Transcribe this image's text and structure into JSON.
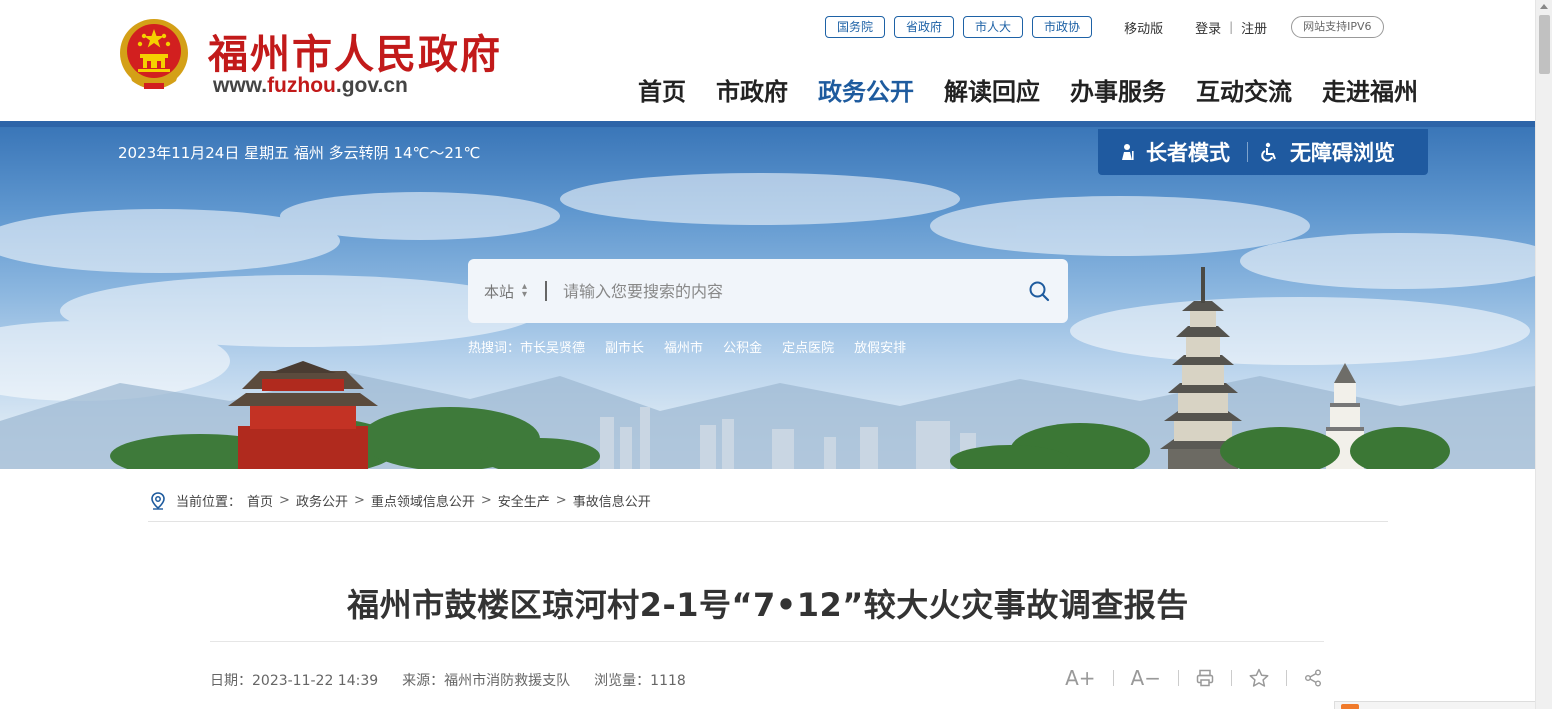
{
  "header": {
    "site_name": "福州市人民政府",
    "site_url_prefix": "www.",
    "site_url_highlight": "fuzhou",
    "site_url_suffix": ".gov.cn",
    "top_pills": [
      "国务院",
      "省政府",
      "市人大",
      "市政协"
    ],
    "mobile_label": "移动版",
    "login_label": "登录",
    "register_label": "注册",
    "separator": "|",
    "ipv6_label": "网站支持IPV6",
    "nav": [
      "首页",
      "市政府",
      "政务公开",
      "解读回应",
      "办事服务",
      "互动交流",
      "走进福州"
    ],
    "nav_active": "政务公开"
  },
  "banner": {
    "date_weather": "2023年11月24日 星期五  福州 多云转阴 14℃～21℃",
    "elder_mode_label": "长者模式",
    "accessible_label": "无障碍浏览",
    "search": {
      "scope": "本站",
      "placeholder": "请输入您要搜索的内容"
    },
    "hot_label": "热搜词：",
    "hot_words": [
      "市长吴贤德",
      "副市长",
      "福州市",
      "公积金",
      "定点医院",
      "放假安排"
    ]
  },
  "article": {
    "breadcrumb_label": "当前位置：",
    "breadcrumb": [
      "首页",
      "政务公开",
      "重点领域信息公开",
      "安全生产",
      "事故信息公开"
    ],
    "breadcrumb_sep": ">",
    "title": "福州市鼓楼区琼河村2-1号“7•12”较大火灾事故调查报告",
    "date": "日期：2023-11-22 14:39",
    "source": "来源：福州市消防救援支队",
    "views": "浏览量：1118",
    "tools": {
      "font_up": "A+",
      "font_down": "A−"
    }
  },
  "colors": {
    "brand_red": "#c21a1a",
    "nav_blue": "#1e5b9e",
    "assist_bg": "#1f5aa0"
  },
  "icons": [
    "location-pin-icon",
    "search-icon",
    "elder-icon",
    "wheelchair-icon",
    "print-icon",
    "star-icon",
    "share-icon",
    "sort-arrows-icon"
  ]
}
